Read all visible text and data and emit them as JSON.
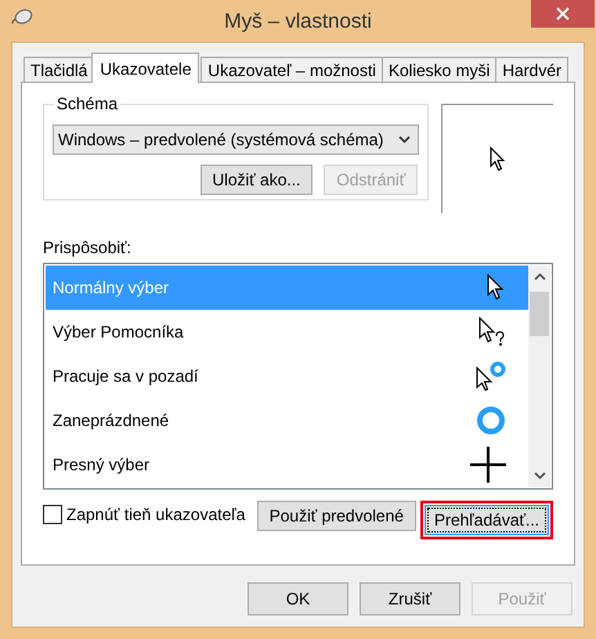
{
  "window": {
    "title": "Myš – vlastnosti"
  },
  "tabs": [
    {
      "label": "Tlačidlá",
      "selected": false
    },
    {
      "label": "Ukazovatele",
      "selected": true
    },
    {
      "label": "Ukazovateľ – možnosti",
      "selected": false
    },
    {
      "label": "Koliesko myši",
      "selected": false
    },
    {
      "label": "Hardvér",
      "selected": false
    }
  ],
  "scheme": {
    "label": "Schéma",
    "value": "Windows – predvolené (systémová schéma)",
    "buttons": [
      {
        "label": "Uložiť ako...",
        "disabled": false
      },
      {
        "label": "Odstrániť",
        "disabled": true
      }
    ]
  },
  "customize": {
    "label": "Prispôsobiť:",
    "items": [
      {
        "label": "Normálny výber",
        "kind": "arrow",
        "selected": true
      },
      {
        "label": "Výber Pomocníka",
        "kind": "help",
        "selected": false
      },
      {
        "label": "Pracuje sa v pozadí",
        "kind": "working",
        "selected": false
      },
      {
        "label": "Zaneprázdnené",
        "kind": "busy",
        "selected": false
      },
      {
        "label": "Presný výber",
        "kind": "precision",
        "selected": false
      }
    ]
  },
  "shadow": {
    "label": "Zapnúť tieň ukazovateľa",
    "checked": false
  },
  "actions": [
    {
      "label": "Použiť predvolené",
      "highlighted": false
    },
    {
      "label": "Prehľadávať...",
      "highlighted": true
    }
  ],
  "footer": [
    {
      "label": "OK",
      "disabled": false
    },
    {
      "label": "Zrušiť",
      "disabled": false
    },
    {
      "label": "Použiť",
      "disabled": true
    }
  ]
}
